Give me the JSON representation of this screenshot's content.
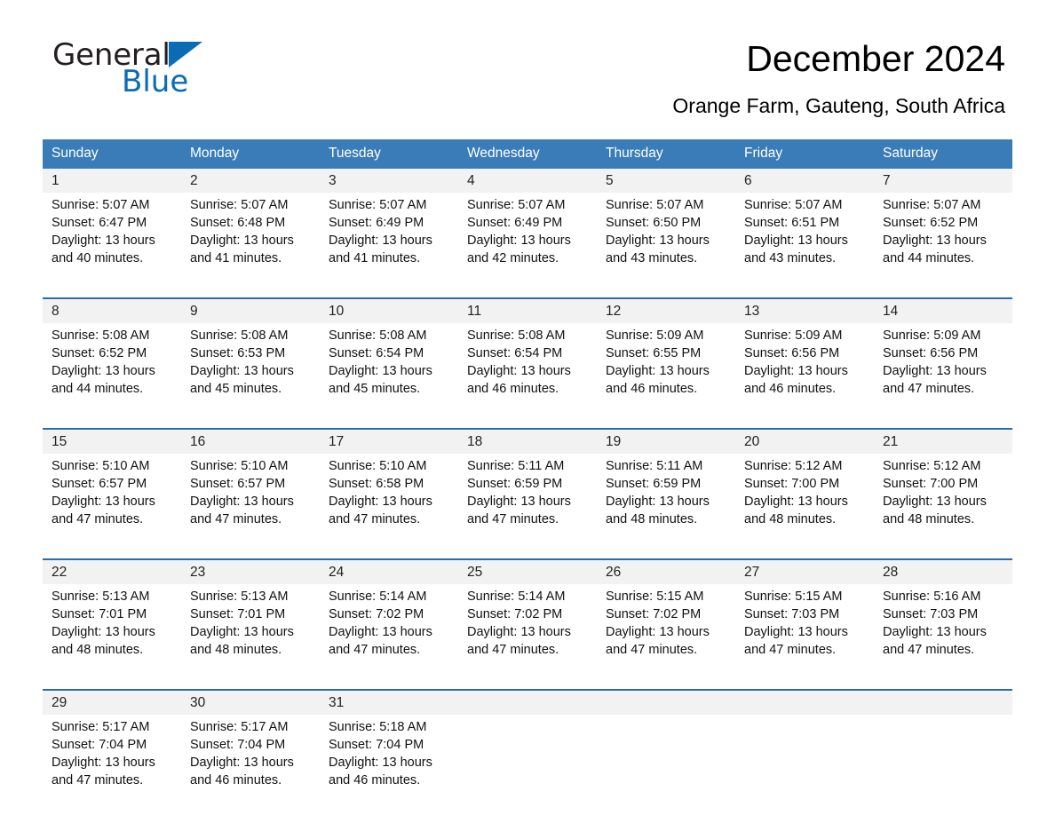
{
  "brand": {
    "name_part1": "General",
    "name_part2": "Blue",
    "accent_color": "#0a6cb4"
  },
  "header": {
    "title": "December 2024",
    "subtitle": "Orange Farm, Gauteng, South Africa"
  },
  "calendar": {
    "header_bg": "#3a7cb8",
    "row_rule_color": "#2d6ca8",
    "daynum_bg": "#f2f2f2",
    "weekday_headers": [
      "Sunday",
      "Monday",
      "Tuesday",
      "Wednesday",
      "Thursday",
      "Friday",
      "Saturday"
    ],
    "weeks": [
      [
        {
          "day": "1",
          "sunrise": "Sunrise: 5:07 AM",
          "sunset": "Sunset: 6:47 PM",
          "daylight_line1": "Daylight: 13 hours",
          "daylight_line2": "and 40 minutes."
        },
        {
          "day": "2",
          "sunrise": "Sunrise: 5:07 AM",
          "sunset": "Sunset: 6:48 PM",
          "daylight_line1": "Daylight: 13 hours",
          "daylight_line2": "and 41 minutes."
        },
        {
          "day": "3",
          "sunrise": "Sunrise: 5:07 AM",
          "sunset": "Sunset: 6:49 PM",
          "daylight_line1": "Daylight: 13 hours",
          "daylight_line2": "and 41 minutes."
        },
        {
          "day": "4",
          "sunrise": "Sunrise: 5:07 AM",
          "sunset": "Sunset: 6:49 PM",
          "daylight_line1": "Daylight: 13 hours",
          "daylight_line2": "and 42 minutes."
        },
        {
          "day": "5",
          "sunrise": "Sunrise: 5:07 AM",
          "sunset": "Sunset: 6:50 PM",
          "daylight_line1": "Daylight: 13 hours",
          "daylight_line2": "and 43 minutes."
        },
        {
          "day": "6",
          "sunrise": "Sunrise: 5:07 AM",
          "sunset": "Sunset: 6:51 PM",
          "daylight_line1": "Daylight: 13 hours",
          "daylight_line2": "and 43 minutes."
        },
        {
          "day": "7",
          "sunrise": "Sunrise: 5:07 AM",
          "sunset": "Sunset: 6:52 PM",
          "daylight_line1": "Daylight: 13 hours",
          "daylight_line2": "and 44 minutes."
        }
      ],
      [
        {
          "day": "8",
          "sunrise": "Sunrise: 5:08 AM",
          "sunset": "Sunset: 6:52 PM",
          "daylight_line1": "Daylight: 13 hours",
          "daylight_line2": "and 44 minutes."
        },
        {
          "day": "9",
          "sunrise": "Sunrise: 5:08 AM",
          "sunset": "Sunset: 6:53 PM",
          "daylight_line1": "Daylight: 13 hours",
          "daylight_line2": "and 45 minutes."
        },
        {
          "day": "10",
          "sunrise": "Sunrise: 5:08 AM",
          "sunset": "Sunset: 6:54 PM",
          "daylight_line1": "Daylight: 13 hours",
          "daylight_line2": "and 45 minutes."
        },
        {
          "day": "11",
          "sunrise": "Sunrise: 5:08 AM",
          "sunset": "Sunset: 6:54 PM",
          "daylight_line1": "Daylight: 13 hours",
          "daylight_line2": "and 46 minutes."
        },
        {
          "day": "12",
          "sunrise": "Sunrise: 5:09 AM",
          "sunset": "Sunset: 6:55 PM",
          "daylight_line1": "Daylight: 13 hours",
          "daylight_line2": "and 46 minutes."
        },
        {
          "day": "13",
          "sunrise": "Sunrise: 5:09 AM",
          "sunset": "Sunset: 6:56 PM",
          "daylight_line1": "Daylight: 13 hours",
          "daylight_line2": "and 46 minutes."
        },
        {
          "day": "14",
          "sunrise": "Sunrise: 5:09 AM",
          "sunset": "Sunset: 6:56 PM",
          "daylight_line1": "Daylight: 13 hours",
          "daylight_line2": "and 47 minutes."
        }
      ],
      [
        {
          "day": "15",
          "sunrise": "Sunrise: 5:10 AM",
          "sunset": "Sunset: 6:57 PM",
          "daylight_line1": "Daylight: 13 hours",
          "daylight_line2": "and 47 minutes."
        },
        {
          "day": "16",
          "sunrise": "Sunrise: 5:10 AM",
          "sunset": "Sunset: 6:57 PM",
          "daylight_line1": "Daylight: 13 hours",
          "daylight_line2": "and 47 minutes."
        },
        {
          "day": "17",
          "sunrise": "Sunrise: 5:10 AM",
          "sunset": "Sunset: 6:58 PM",
          "daylight_line1": "Daylight: 13 hours",
          "daylight_line2": "and 47 minutes."
        },
        {
          "day": "18",
          "sunrise": "Sunrise: 5:11 AM",
          "sunset": "Sunset: 6:59 PM",
          "daylight_line1": "Daylight: 13 hours",
          "daylight_line2": "and 47 minutes."
        },
        {
          "day": "19",
          "sunrise": "Sunrise: 5:11 AM",
          "sunset": "Sunset: 6:59 PM",
          "daylight_line1": "Daylight: 13 hours",
          "daylight_line2": "and 48 minutes."
        },
        {
          "day": "20",
          "sunrise": "Sunrise: 5:12 AM",
          "sunset": "Sunset: 7:00 PM",
          "daylight_line1": "Daylight: 13 hours",
          "daylight_line2": "and 48 minutes."
        },
        {
          "day": "21",
          "sunrise": "Sunrise: 5:12 AM",
          "sunset": "Sunset: 7:00 PM",
          "daylight_line1": "Daylight: 13 hours",
          "daylight_line2": "and 48 minutes."
        }
      ],
      [
        {
          "day": "22",
          "sunrise": "Sunrise: 5:13 AM",
          "sunset": "Sunset: 7:01 PM",
          "daylight_line1": "Daylight: 13 hours",
          "daylight_line2": "and 48 minutes."
        },
        {
          "day": "23",
          "sunrise": "Sunrise: 5:13 AM",
          "sunset": "Sunset: 7:01 PM",
          "daylight_line1": "Daylight: 13 hours",
          "daylight_line2": "and 48 minutes."
        },
        {
          "day": "24",
          "sunrise": "Sunrise: 5:14 AM",
          "sunset": "Sunset: 7:02 PM",
          "daylight_line1": "Daylight: 13 hours",
          "daylight_line2": "and 47 minutes."
        },
        {
          "day": "25",
          "sunrise": "Sunrise: 5:14 AM",
          "sunset": "Sunset: 7:02 PM",
          "daylight_line1": "Daylight: 13 hours",
          "daylight_line2": "and 47 minutes."
        },
        {
          "day": "26",
          "sunrise": "Sunrise: 5:15 AM",
          "sunset": "Sunset: 7:02 PM",
          "daylight_line1": "Daylight: 13 hours",
          "daylight_line2": "and 47 minutes."
        },
        {
          "day": "27",
          "sunrise": "Sunrise: 5:15 AM",
          "sunset": "Sunset: 7:03 PM",
          "daylight_line1": "Daylight: 13 hours",
          "daylight_line2": "and 47 minutes."
        },
        {
          "day": "28",
          "sunrise": "Sunrise: 5:16 AM",
          "sunset": "Sunset: 7:03 PM",
          "daylight_line1": "Daylight: 13 hours",
          "daylight_line2": "and 47 minutes."
        }
      ],
      [
        {
          "day": "29",
          "sunrise": "Sunrise: 5:17 AM",
          "sunset": "Sunset: 7:04 PM",
          "daylight_line1": "Daylight: 13 hours",
          "daylight_line2": "and 47 minutes."
        },
        {
          "day": "30",
          "sunrise": "Sunrise: 5:17 AM",
          "sunset": "Sunset: 7:04 PM",
          "daylight_line1": "Daylight: 13 hours",
          "daylight_line2": "and 46 minutes."
        },
        {
          "day": "31",
          "sunrise": "Sunrise: 5:18 AM",
          "sunset": "Sunset: 7:04 PM",
          "daylight_line1": "Daylight: 13 hours",
          "daylight_line2": "and 46 minutes."
        },
        {
          "day": "",
          "sunrise": "",
          "sunset": "",
          "daylight_line1": "",
          "daylight_line2": ""
        },
        {
          "day": "",
          "sunrise": "",
          "sunset": "",
          "daylight_line1": "",
          "daylight_line2": ""
        },
        {
          "day": "",
          "sunrise": "",
          "sunset": "",
          "daylight_line1": "",
          "daylight_line2": ""
        },
        {
          "day": "",
          "sunrise": "",
          "sunset": "",
          "daylight_line1": "",
          "daylight_line2": ""
        }
      ]
    ]
  }
}
